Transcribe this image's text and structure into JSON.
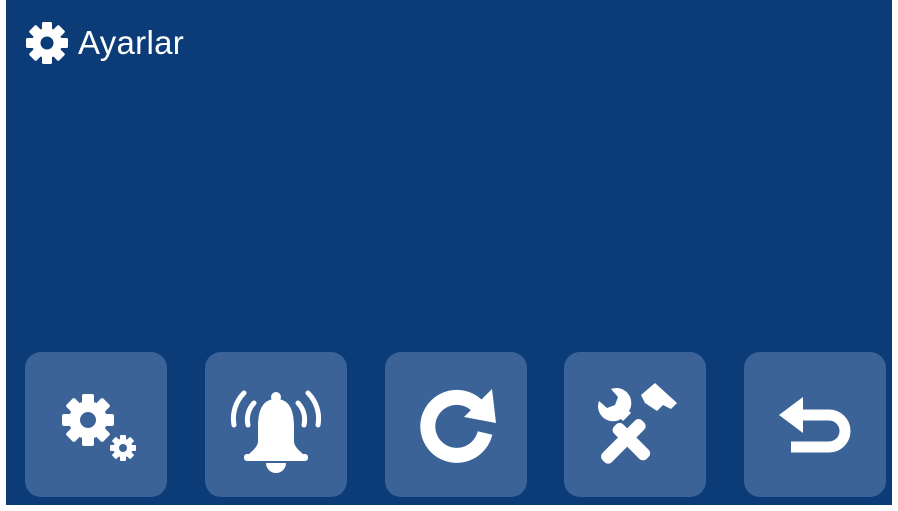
{
  "header": {
    "title": "Ayarlar",
    "icon": "gear-icon"
  },
  "toolbar": {
    "buttons": [
      {
        "name": "settings-button",
        "icon": "gears-icon"
      },
      {
        "name": "alarm-button",
        "icon": "ringing-bell-icon"
      },
      {
        "name": "refresh-button",
        "icon": "refresh-icon"
      },
      {
        "name": "tools-button",
        "icon": "wrench-hammer-icon"
      },
      {
        "name": "back-button",
        "icon": "back-arrow-icon"
      }
    ]
  },
  "colors": {
    "background": "#0b3c78",
    "button": "#3b6397",
    "foreground": "#ffffff"
  }
}
